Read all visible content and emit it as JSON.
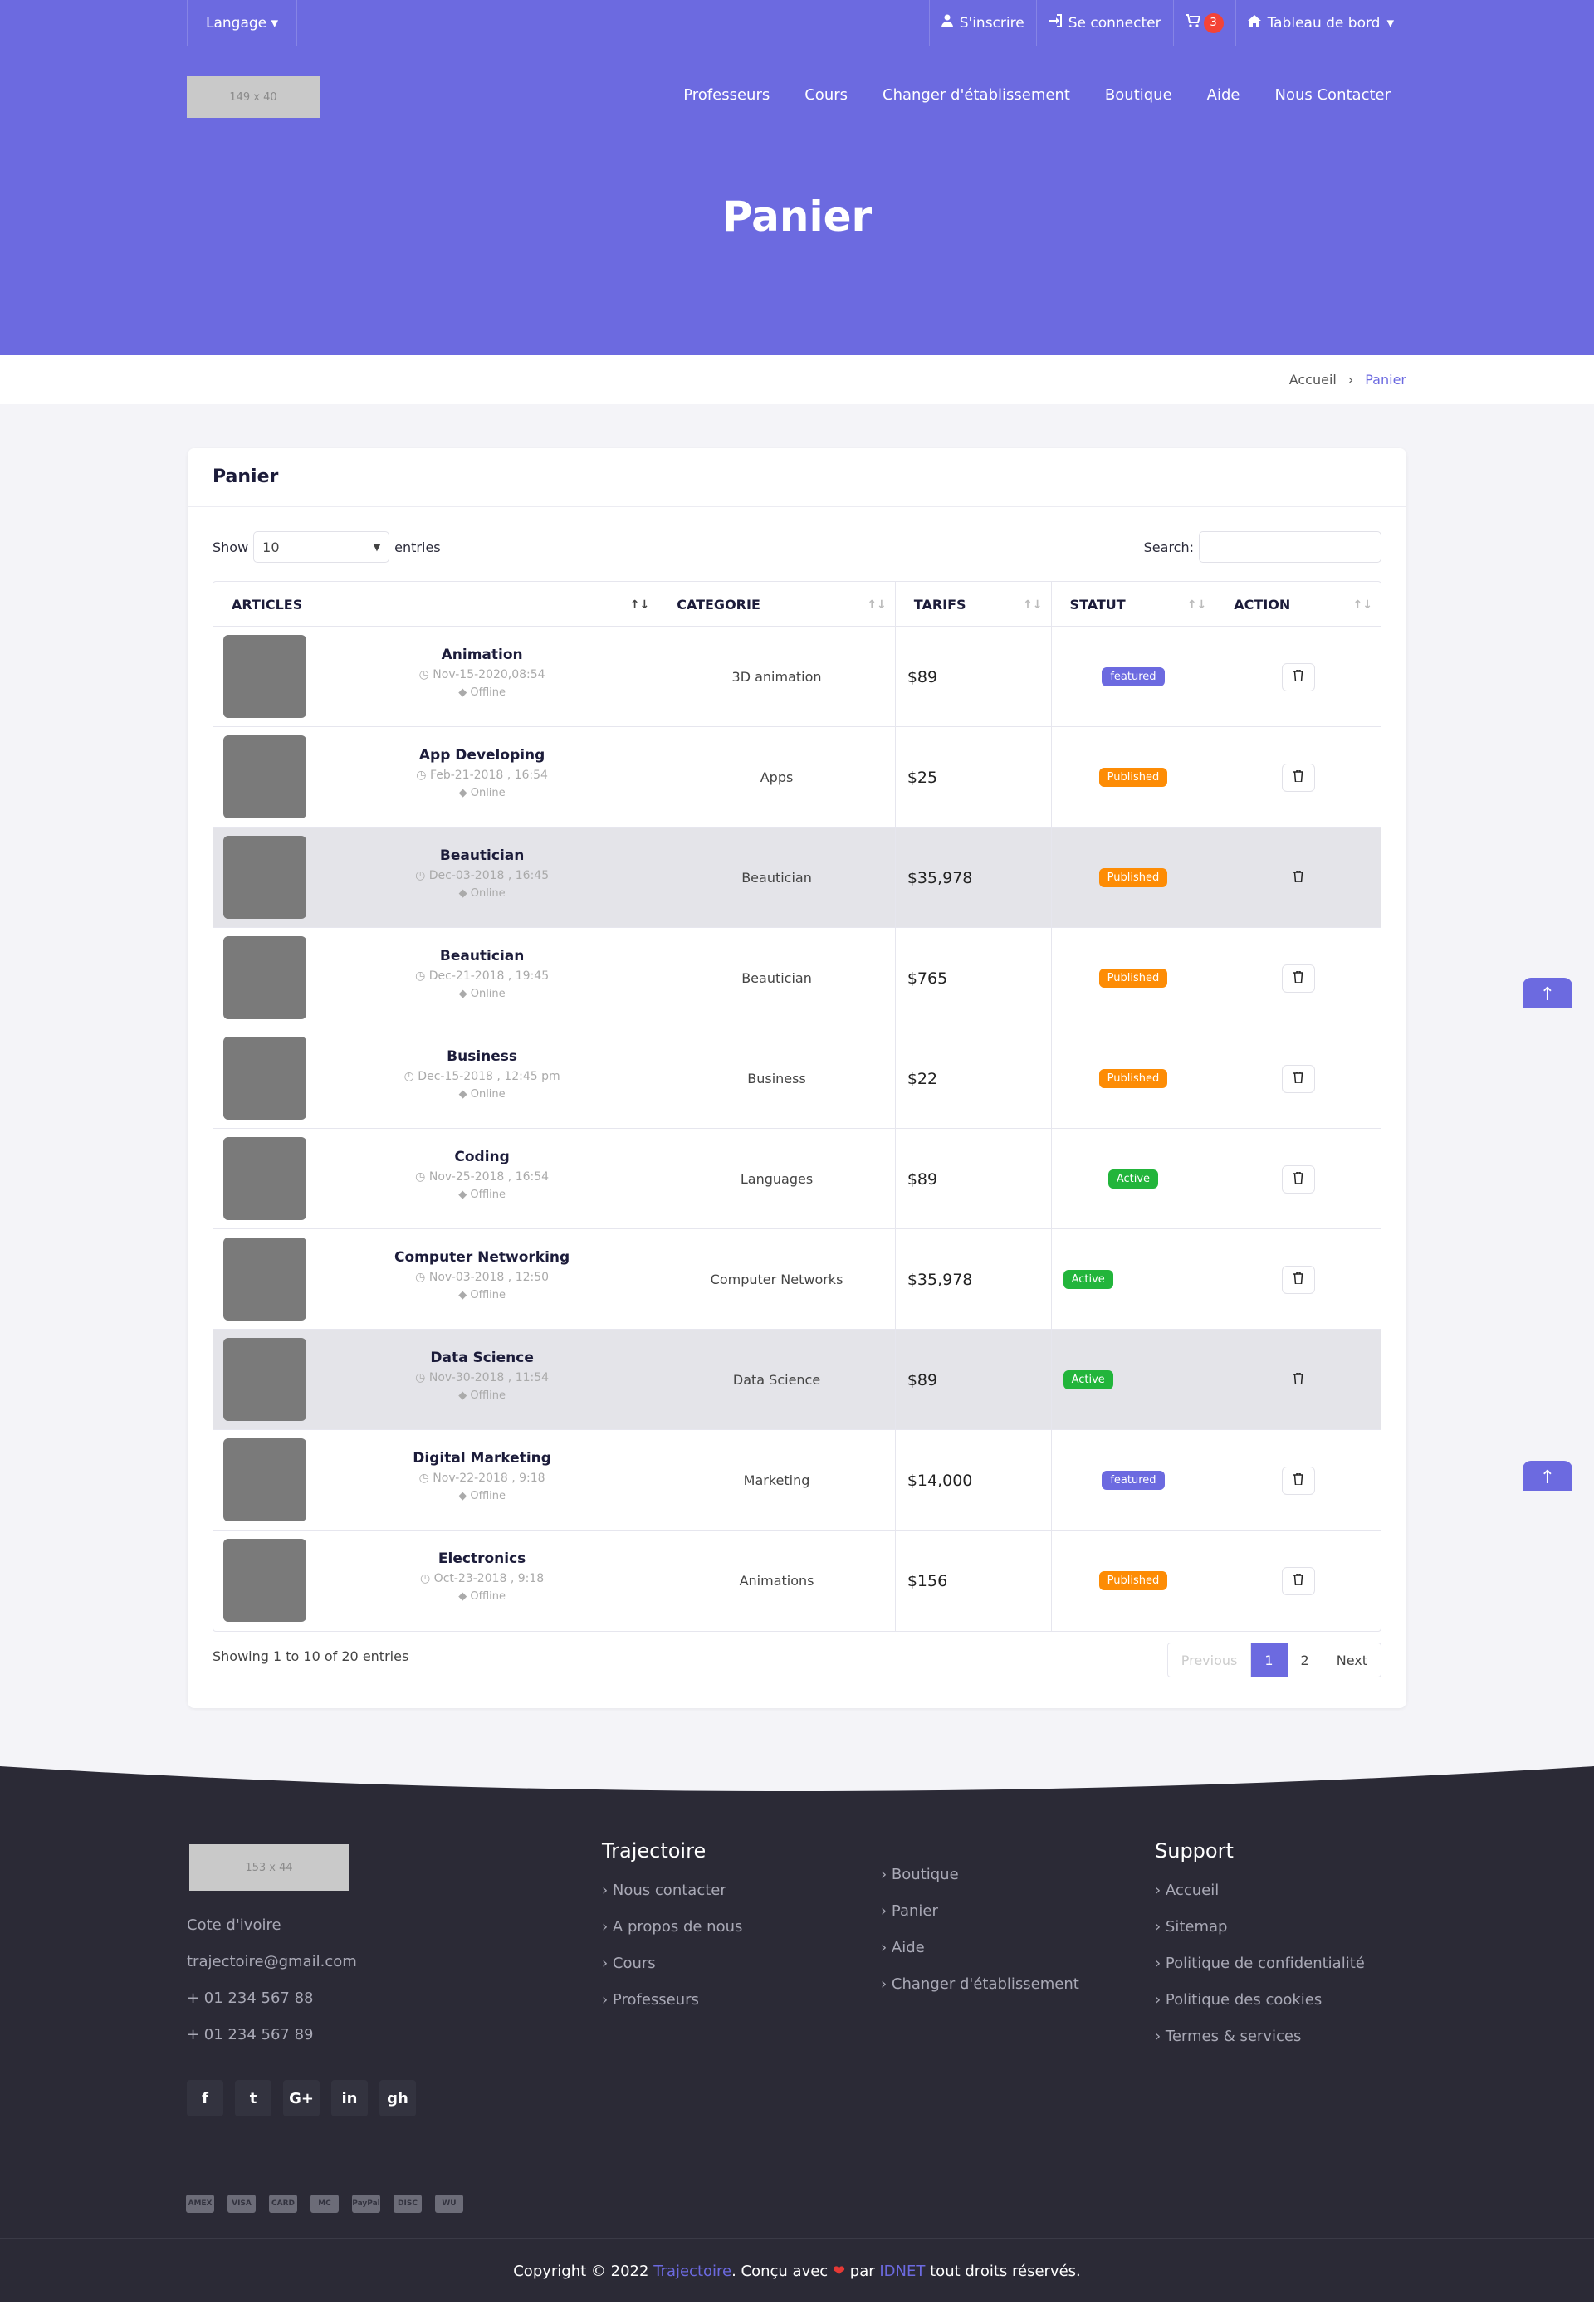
{
  "topbar": {
    "language": "Langage",
    "signup": "S'inscrire",
    "login": "Se connecter",
    "cart_count": "3",
    "dashboard": "Tableau de bord"
  },
  "header": {
    "logo_placeholder": "149 x 40",
    "nav": [
      "Professeurs",
      "Cours",
      "Changer d'établissement",
      "Boutique",
      "Aide",
      "Nous Contacter"
    ],
    "title": "Panier"
  },
  "breadcrumb": {
    "home": "Accueil",
    "current": "Panier"
  },
  "cart": {
    "title": "Panier",
    "show_label": "Show",
    "entries_value": "10",
    "entries_label": "entries",
    "search_label": "Search:",
    "columns": [
      "ARTICLES",
      "CATEGORIE",
      "TARIFS",
      "STATUT",
      "ACTION"
    ],
    "rows": [
      {
        "name": "Animation",
        "date": "Nov-15-2020,08:54",
        "mode": "Offline",
        "category": "3D animation",
        "price": "$89",
        "status": "featured"
      },
      {
        "name": "App Developing",
        "date": "Feb-21-2018 , 16:54",
        "mode": "Online",
        "category": "Apps",
        "price": "$25",
        "status": "Published"
      },
      {
        "name": "Beautician",
        "date": "Dec-03-2018 , 16:45",
        "mode": "Online",
        "category": "Beautician",
        "price": "$35,978",
        "status": "Published"
      },
      {
        "name": "Beautician",
        "date": "Dec-21-2018 , 19:45",
        "mode": "Online",
        "category": "Beautician",
        "price": "$765",
        "status": "Published"
      },
      {
        "name": "Business",
        "date": "Dec-15-2018 , 12:45 pm",
        "mode": "Online",
        "category": "Business",
        "price": "$22",
        "status": "Published"
      },
      {
        "name": "Coding",
        "date": "Nov-25-2018 , 16:54",
        "mode": "Offline",
        "category": "Languages",
        "price": "$89",
        "status": "Active"
      },
      {
        "name": "Computer Networking",
        "date": "Nov-03-2018 , 12:50",
        "mode": "Offline",
        "category": "Computer Networks",
        "price": "$35,978",
        "status": "Active"
      },
      {
        "name": "Data Science",
        "date": "Nov-30-2018 , 11:54",
        "mode": "Offline",
        "category": "Data Science",
        "price": "$89",
        "status": "Active"
      },
      {
        "name": "Digital Marketing",
        "date": "Nov-22-2018 , 9:18",
        "mode": "Offline",
        "category": "Marketing",
        "price": "$14,000",
        "status": "featured"
      },
      {
        "name": "Electronics",
        "date": "Oct-23-2018 , 9:18",
        "mode": "Offline",
        "category": "Animations",
        "price": "$156",
        "status": "Published"
      }
    ],
    "info": "Showing 1 to 10 of 20 entries",
    "pagination": {
      "previous": "Previous",
      "pages": [
        "1",
        "2"
      ],
      "next": "Next"
    }
  },
  "footer": {
    "logo_placeholder": "153 x 44",
    "contact": [
      "Cote d'ivoire",
      "trajectoire@gmail.com",
      "+ 01 234 567 88",
      "+ 01 234 567 89"
    ],
    "col1_title": "Trajectoire",
    "col1_links": [
      "Nous contacter",
      "A propos de nous",
      "Cours",
      "Professeurs"
    ],
    "col2_links": [
      "Boutique",
      "Panier",
      "Aide",
      "Changer d'établissement"
    ],
    "col3_title": "Support",
    "col3_links": [
      "Accueil",
      "Sitemap",
      "Politique de confidentialité",
      "Politique des cookies",
      "Termes & services"
    ],
    "social": [
      "f",
      "t",
      "G+",
      "in",
      "gh"
    ],
    "payment": [
      "AMEX",
      "VISA",
      "CARD",
      "MC",
      "PayPal",
      "DISC",
      "WU"
    ],
    "copyright_pre": "Copyright © 2022",
    "brand": "Trajectoire",
    "copyright_mid": ". Conçu avec",
    "heart": "❤",
    "par": "par",
    "author": "IDNET",
    "copyright_post": "tout droits réservés."
  },
  "colors": {
    "primary": "#6c6ae0",
    "featured": "#6c6ae0",
    "published": "#fd8c05",
    "active": "#22b53b",
    "footer_bg": "#2b2a36",
    "cart_badge": "#f44336"
  }
}
